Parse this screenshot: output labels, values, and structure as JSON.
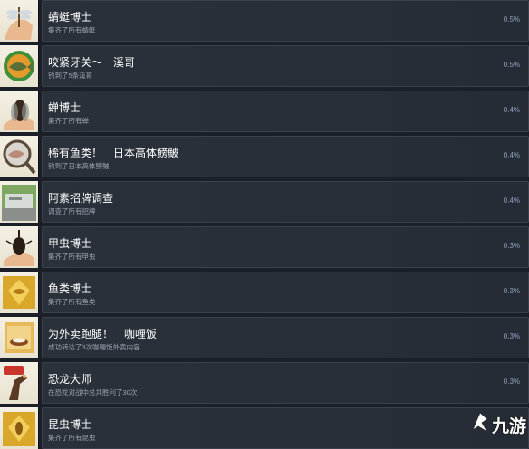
{
  "achievements": [
    {
      "title": "蜻蜓博士",
      "desc": "集齐了所有蜻蜓",
      "pct": "0.5%",
      "icon": "dragonfly-hand-icon"
    },
    {
      "title": "咬紧牙关～　溪哥",
      "desc": "钓到了5条溪哥",
      "pct": "0.5%",
      "icon": "fish-badge-icon"
    },
    {
      "title": "蝉博士",
      "desc": "集齐了所有蝉",
      "pct": "0.4%",
      "icon": "cicada-hand-icon"
    },
    {
      "title": "稀有鱼类！　日本高体鳑鲏",
      "desc": "钓到了日本高体鳑鲏",
      "pct": "0.4%",
      "icon": "magnifier-fish-icon"
    },
    {
      "title": "阿素招牌调查",
      "desc": "调查了所有招牌",
      "pct": "0.4%",
      "icon": "signboard-icon"
    },
    {
      "title": "甲虫博士",
      "desc": "集齐了所有甲虫",
      "pct": "0.3%",
      "icon": "beetle-hand-icon"
    },
    {
      "title": "鱼类博士",
      "desc": "集齐了所有鱼类",
      "pct": "0.3%",
      "icon": "gold-fish-medal-icon"
    },
    {
      "title": "为外卖跑腿！　咖喱饭",
      "desc": "成功转达了3次咖喱饭外卖内容",
      "pct": "0.3%",
      "icon": "curry-box-icon"
    },
    {
      "title": "恐龙大师",
      "desc": "在恐龙对战中总共胜利了30次",
      "pct": "0.3%",
      "icon": "dinosaur-30-icon"
    },
    {
      "title": "昆虫博士",
      "desc": "集齐了所有昆虫",
      "pct": "",
      "icon": "gold-insect-medal-icon"
    }
  ],
  "watermark": {
    "text": "九游",
    "icon": "jiuyou-logo-icon"
  },
  "colors": {
    "background": "#1b2028",
    "card": "#2a313b",
    "title": "#ffffff",
    "desc": "#9aa4b0",
    "percent": "#8fa3c0"
  }
}
